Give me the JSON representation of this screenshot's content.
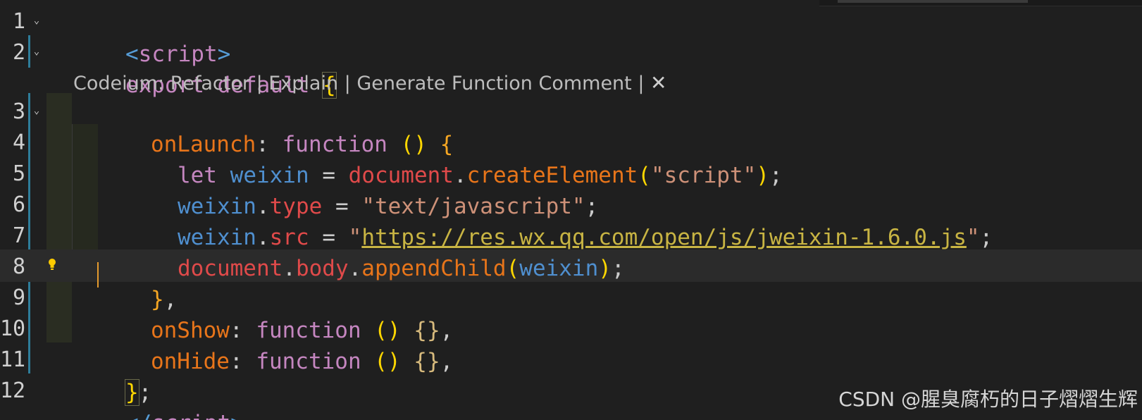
{
  "editor": {
    "line_numbers": [
      "1",
      "2",
      "3",
      "4",
      "5",
      "6",
      "7",
      "8",
      "9",
      "10",
      "11",
      "12"
    ],
    "fold_glyph": "⌄",
    "codelens": {
      "prefix": "Codeium: ",
      "refactor": "Refactor",
      "explain": "Explain",
      "generate": "Generate Function Comment",
      "sep": " | ",
      "close": "✕"
    },
    "lines": {
      "l1": {
        "open": "<",
        "name": "script",
        "close": ">"
      },
      "l2": {
        "kw1": "export",
        "kw2": "default",
        "brace": "{"
      },
      "l3": {
        "prop": "onLaunch",
        "colon": ":",
        "fn": "function",
        "parens": "()",
        "brace": "{"
      },
      "l4": {
        "kw": "let",
        "var": "weixin",
        "eq": "=",
        "obj": "document",
        "dot": ".",
        "method": "createElement",
        "popen": "(",
        "str": "\"script\"",
        "pclose": ")",
        "semi": ";"
      },
      "l5": {
        "var": "weixin",
        "dot": ".",
        "member": "type",
        "eq": "=",
        "str": "\"text/javascript\"",
        "semi": ";"
      },
      "l6": {
        "var": "weixin",
        "dot": ".",
        "member": "src",
        "eq": "=",
        "q1": "\"",
        "url": "https://res.wx.qq.com/open/js/jweixin-1.6.0.js",
        "q2": "\"",
        "semi": ";"
      },
      "l7": {
        "obj": "document",
        "dot1": ".",
        "member": "body",
        "dot2": ".",
        "method": "appendChild",
        "popen": "(",
        "arg": "weixin",
        "pclose": ")",
        "semi": ";"
      },
      "l8": {
        "brace": "}",
        "comma": ","
      },
      "l9": {
        "prop": "onShow",
        "colon": ":",
        "fn": "function",
        "parens": "()",
        "body": "{}",
        "comma": ","
      },
      "l10": {
        "prop": "onHide",
        "colon": ":",
        "fn": "function",
        "parens": "()",
        "body": "{}",
        "comma": ","
      },
      "l11": {
        "brace": "}",
        "semi": ";"
      },
      "l12": {
        "open": "</",
        "name": "script",
        "close": ">"
      }
    }
  },
  "watermark": "CSDN @腥臭腐朽的日子熠熠生辉",
  "icons": {
    "lightbulb": "lightbulb-icon"
  },
  "colors": {
    "background": "#1f1f1f",
    "current_line": "#2b2b2b",
    "keyword": "#c586c0",
    "string": "#ce9178",
    "variable": "#4f8fcf",
    "property": "#e8751a"
  }
}
